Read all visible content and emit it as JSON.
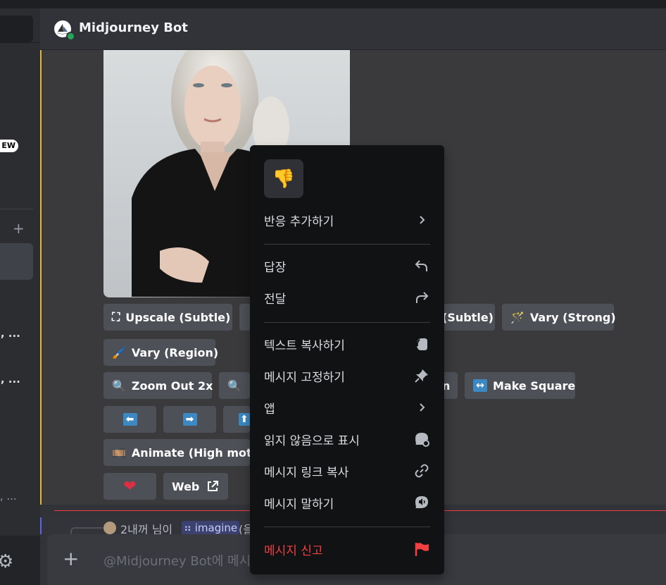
{
  "header": {
    "title": "Midjourney Bot"
  },
  "sidebar": {
    "badge": "EW",
    "dm_items": [
      "), ...",
      "), ...",
      "), ..."
    ]
  },
  "buttons": {
    "upscale_subtle": "Upscale (Subtle)",
    "vary_subtle": "(Subtle)",
    "vary_strong": "Vary (Strong)",
    "vary_region": "Vary (Region)",
    "zoom_out_2x": "Zoom Out 2x",
    "custom_zoom_tail": "n",
    "make_square": "Make Square",
    "animate_high": "Animate (High motion",
    "web": "Web"
  },
  "reply": {
    "user": "2내꺼 님이",
    "command": "imagine",
    "tail": "(을"
  },
  "composer": {
    "placeholder": "@Midjourney Bot에 메시"
  },
  "menu": {
    "quick_reaction": "👎",
    "items": [
      {
        "label": "반응 추가하기",
        "icon": "chevron-right"
      },
      {
        "label": "답장",
        "icon": "reply"
      },
      {
        "label": "전달",
        "icon": "forward"
      },
      {
        "label": "텍스트 복사하기",
        "icon": "copy-text"
      },
      {
        "label": "메시지 고정하기",
        "icon": "pin"
      },
      {
        "label": "앱",
        "icon": "chevron-right"
      },
      {
        "label": "읽지 않음으로 표시",
        "icon": "mark-unread"
      },
      {
        "label": "메시지 링크 복사",
        "icon": "link"
      },
      {
        "label": "메시지 말하기",
        "icon": "speak"
      },
      {
        "label": "메시지 신고",
        "icon": "flag"
      }
    ]
  },
  "colors": {
    "accent": "#5865f2",
    "danger": "#f23f43",
    "highlight": "#f0b232",
    "online": "#23a55a"
  }
}
